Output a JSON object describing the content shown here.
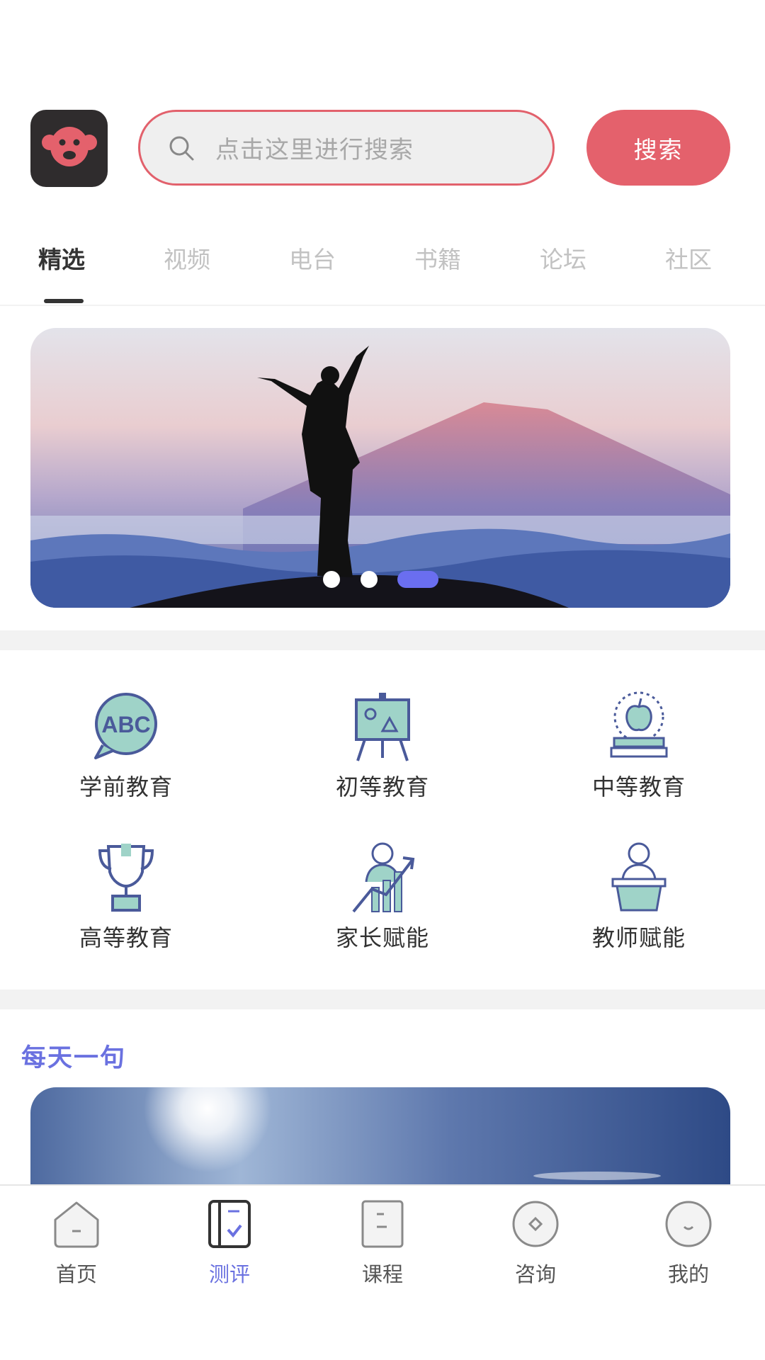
{
  "header": {
    "logo_name": "monkey-logo",
    "search_placeholder": "点击这里进行搜索",
    "search_button": "搜索"
  },
  "tabs": [
    {
      "label": "精选",
      "active": true
    },
    {
      "label": "视频",
      "active": false
    },
    {
      "label": "电台",
      "active": false
    },
    {
      "label": "书籍",
      "active": false
    },
    {
      "label": "论坛",
      "active": false
    },
    {
      "label": "社区",
      "active": false
    }
  ],
  "banner": {
    "slide_count": 3,
    "active_slide": 3
  },
  "categories": [
    {
      "label": "学前教育",
      "icon": "abc-bubble-icon"
    },
    {
      "label": "初等教育",
      "icon": "easel-icon"
    },
    {
      "label": "中等教育",
      "icon": "apple-books-icon"
    },
    {
      "label": "高等教育",
      "icon": "trophy-icon"
    },
    {
      "label": "家长赋能",
      "icon": "growth-chart-person-icon"
    },
    {
      "label": "教师赋能",
      "icon": "teacher-podium-icon"
    }
  ],
  "daily": {
    "title": "每天一句"
  },
  "bottom_nav": [
    {
      "label": "首页",
      "icon": "home-icon",
      "active": false
    },
    {
      "label": "测评",
      "icon": "assessment-icon",
      "active": true
    },
    {
      "label": "课程",
      "icon": "course-icon",
      "active": false
    },
    {
      "label": "咨询",
      "icon": "consult-icon",
      "active": false
    },
    {
      "label": "我的",
      "icon": "profile-icon",
      "active": false
    }
  ],
  "colors": {
    "brand_red": "#e4616c",
    "accent_purple": "#6a71e0",
    "icon_teal": "#7fc4b8",
    "icon_navy": "#4a5a9a"
  }
}
